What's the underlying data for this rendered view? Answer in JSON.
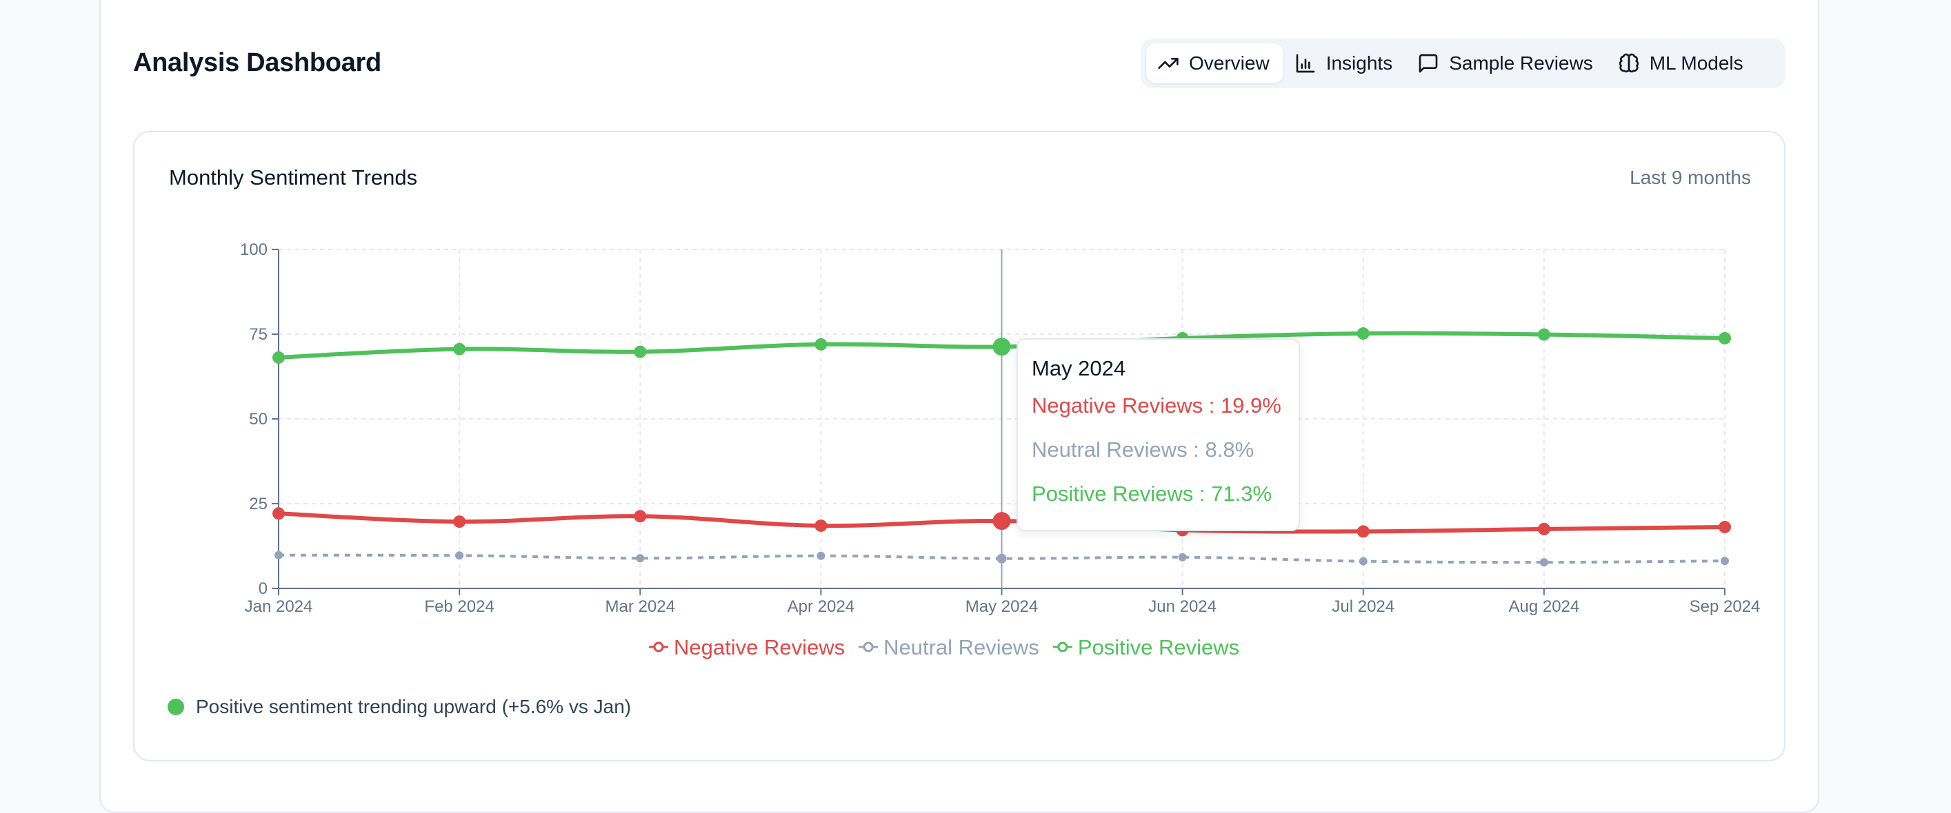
{
  "page": {
    "title": "Analysis Dashboard"
  },
  "tabs": [
    {
      "label": "Overview",
      "icon": "trending-up-icon",
      "active": true
    },
    {
      "label": "Insights",
      "icon": "bar-chart-icon",
      "active": false
    },
    {
      "label": "Sample Reviews",
      "icon": "message-square-icon",
      "active": false
    },
    {
      "label": "ML Models",
      "icon": "brain-icon",
      "active": false
    }
  ],
  "chart_card": {
    "title": "Monthly Sentiment Trends",
    "range_label": "Last 9 months",
    "insight_text": "Positive sentiment trending upward (+5.6% vs Jan)",
    "insight_dot_color": "#4ec15a"
  },
  "tooltip": {
    "title": "May 2024",
    "rows": [
      {
        "text": "Negative Reviews : 19.9%",
        "color": "#e04848"
      },
      {
        "text": "Neutral Reviews : 8.8%",
        "color": "#94a3b8"
      },
      {
        "text": "Positive Reviews : 71.3%",
        "color": "#4ec15a"
      }
    ]
  },
  "chart_data": {
    "type": "line",
    "categories": [
      "Jan 2024",
      "Feb 2024",
      "Mar 2024",
      "Apr 2024",
      "May 2024",
      "Jun 2024",
      "Jul 2024",
      "Aug 2024",
      "Sep 2024"
    ],
    "ylim": [
      0,
      100
    ],
    "yticks": [
      0,
      25,
      50,
      75,
      100
    ],
    "grid": true,
    "legend_position": "bottom-center",
    "active_category": "May 2024",
    "series": [
      {
        "name": "Negative Reviews",
        "color": "#e04848",
        "dashed": false,
        "values": [
          22.1,
          19.7,
          21.3,
          18.5,
          19.9,
          17.2,
          16.8,
          17.5,
          18.1
        ]
      },
      {
        "name": "Neutral Reviews",
        "color": "#94a3b8",
        "dashed": true,
        "values": [
          9.8,
          9.7,
          8.9,
          9.6,
          8.8,
          9.2,
          8.0,
          7.7,
          8.1
        ]
      },
      {
        "name": "Positive Reviews",
        "color": "#4ec15a",
        "dashed": false,
        "values": [
          68.1,
          70.6,
          69.8,
          72.0,
          71.3,
          73.8,
          75.2,
          74.9,
          73.8
        ]
      }
    ]
  }
}
